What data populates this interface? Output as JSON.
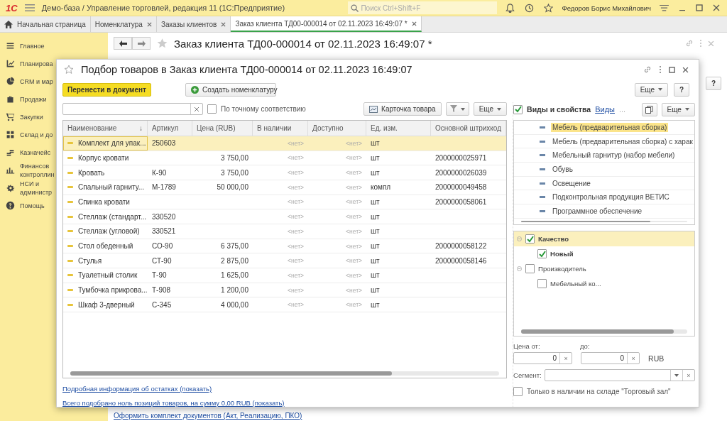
{
  "app_bar": {
    "logo": "1С",
    "title": "Демо-база / Управление торговлей, редакция 11  (1С:Предприятие)",
    "search": {
      "placeholder": "Поиск Ctrl+Shift+F"
    },
    "user": "Федоров Борис Михайлович"
  },
  "tabs": [
    {
      "label": "Начальная страница",
      "kind": "home",
      "selected": false
    },
    {
      "label": "Номенклатура",
      "kind": "doc",
      "selected": false
    },
    {
      "label": "Заказы клиентов",
      "kind": "doc",
      "selected": false
    },
    {
      "label": "Заказ клиента ТД00-000014 от 02.11.2023 16:49:07 *",
      "kind": "doc",
      "selected": true
    }
  ],
  "sidebar": {
    "items": [
      {
        "lines": [
          "Главное"
        ]
      },
      {
        "lines": [
          "Планирова"
        ]
      },
      {
        "lines": [
          "CRM и мар"
        ]
      },
      {
        "lines": [
          "Продажи"
        ]
      },
      {
        "lines": [
          "Закупки"
        ]
      },
      {
        "lines": [
          "Склад и до"
        ]
      },
      {
        "lines": [
          "Казначейс"
        ]
      },
      {
        "lines": [
          "Финансов",
          "контроллин"
        ]
      },
      {
        "lines": [
          "НСИ и",
          "администр"
        ]
      },
      {
        "lines": [
          "Помощь"
        ]
      }
    ]
  },
  "document": {
    "title": "Заказ клиента ТД00-000014 от 02.11.2023 16:49:07 *",
    "help": "?",
    "footer_link": "Оформить комплект документов (Акт, Реализацию, ПКО)"
  },
  "dialog": {
    "title": "Подбор товаров в Заказ клиента ТД00-000014 от 02.11.2023 16:49:07",
    "transfer_button": "Перенести в документ",
    "create_button": "Создать номенклатуру",
    "more_button": "Еще",
    "help_button": "?",
    "exact_match": {
      "label": "По точному соответствию",
      "checked": false
    },
    "card_button": "Карточка товара",
    "table_more": "Еще",
    "table": {
      "columns": [
        "Наименование",
        "Артикул",
        "Цена (RUB)",
        "В наличии",
        "Доступно",
        "Ед. изм.",
        "Основной штрихкод"
      ],
      "sort_mark": "↓",
      "rows": [
        {
          "name": "Комплект для упак...",
          "article": "250603",
          "in_stock": "<нет>",
          "available": "<нет>",
          "unit": "шт",
          "selected": true
        },
        {
          "name": "Корпус кровати",
          "price": "3 750,00",
          "in_stock": "<нет>",
          "available": "<нет>",
          "unit": "шт",
          "barcode": "2000000025971",
          "selected": false
        },
        {
          "name": "Кровать",
          "article": "К-90",
          "price": "3 750,00",
          "in_stock": "<нет>",
          "available": "<нет>",
          "unit": "шт",
          "barcode": "2000000026039",
          "selected": false
        },
        {
          "name": "Спальный гарниту...",
          "article": "М-1789",
          "price": "50 000,00",
          "in_stock": "<нет>",
          "available": "<нет>",
          "unit": "компл",
          "barcode": "2000000049458",
          "selected": false
        },
        {
          "name": "Спинка кровати",
          "in_stock": "<нет>",
          "available": "<нет>",
          "unit": "шт",
          "barcode": "2000000058061",
          "selected": false
        },
        {
          "name": "Стеллаж (стандарт...",
          "article": "330520",
          "in_stock": "<нет>",
          "available": "<нет>",
          "unit": "шт",
          "selected": false
        },
        {
          "name": "Стеллаж (угловой)",
          "article": "330521",
          "in_stock": "<нет>",
          "available": "<нет>",
          "unit": "шт",
          "selected": false
        },
        {
          "name": "Стол обеденный",
          "article": "СО-90",
          "price": "6 375,00",
          "in_stock": "<нет>",
          "available": "<нет>",
          "unit": "шт",
          "barcode": "2000000058122",
          "selected": false
        },
        {
          "name": "Стулья",
          "article": "СТ-90",
          "price": "2 875,00",
          "in_stock": "<нет>",
          "available": "<нет>",
          "unit": "шт",
          "barcode": "2000000058146",
          "selected": false
        },
        {
          "name": "Туалетный столик",
          "article": "Т-90",
          "price": "1 625,00",
          "in_stock": "<нет>",
          "available": "<нет>",
          "unit": "шт",
          "selected": false
        },
        {
          "name": "Тумбочка прикрова...",
          "article": "Т-908",
          "price": "1 200,00",
          "in_stock": "<нет>",
          "available": "<нет>",
          "unit": "шт",
          "selected": false
        },
        {
          "name": "Шкаф 3-дверный",
          "article": "С-345",
          "price": "4 000,00",
          "in_stock": "<нет>",
          "available": "<нет>",
          "unit": "шт",
          "selected": false
        }
      ]
    },
    "stock_link": "Подробная информация об остатках (показать)",
    "total_link": "Всего подобрано ноль позиций товаров, на сумму 0,00 RUB (показать)",
    "kinds": {
      "label": "Виды и свойства",
      "checked": true,
      "link": "Виды",
      "ellipsis": "...",
      "more_button": "Еще",
      "items": [
        {
          "label": "Мебель (предварительная сборка)",
          "selected": true
        },
        {
          "label": "Мебель (предварительная сборка) с харак",
          "selected": false
        },
        {
          "label": "Мебельный гарнитур (набор мебели)",
          "selected": false
        },
        {
          "label": "Обувь",
          "selected": false
        },
        {
          "label": "Освещение",
          "selected": false
        },
        {
          "label": "Подконтрольная продукция ВЕТИС",
          "selected": false
        },
        {
          "label": "Программное обеспечение",
          "selected": false
        }
      ]
    },
    "properties": [
      {
        "label": "Качество",
        "checked": true,
        "expanded": true,
        "selected": true,
        "children": [
          {
            "label": "Новый",
            "checked": true,
            "selected": false
          }
        ]
      },
      {
        "label": "Производитель",
        "checked": false,
        "expanded": true,
        "selected": false,
        "children": [
          {
            "label": "Мебельный ко...",
            "checked": false,
            "selected": false
          }
        ]
      }
    ],
    "price": {
      "from_label": "Цена от:",
      "from": "0",
      "to_label": "до:",
      "to": "0",
      "currency": "RUB",
      "clear": "×"
    },
    "segment": {
      "label": "Сегмент:",
      "clear": "×"
    },
    "stock_only": {
      "label": "Только в наличии на складе \"Торговый зал\"",
      "checked": false
    }
  }
}
